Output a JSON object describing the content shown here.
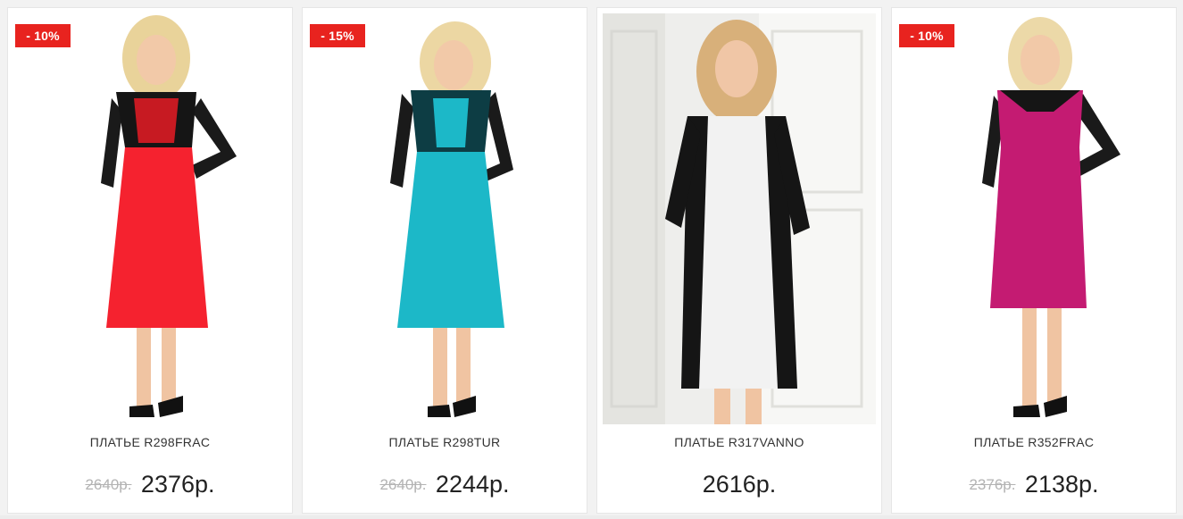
{
  "products": [
    {
      "badge": "- 10%",
      "title": "ПЛАТЬЕ R298FRAC",
      "old_price": "2640р.",
      "price": "2376р.",
      "dress_color": "#f5222f",
      "image_alt": "dress-red"
    },
    {
      "badge": "- 15%",
      "title": "ПЛАТЬЕ R298TUR",
      "old_price": "2640р.",
      "price": "2244р.",
      "dress_color": "#1cb8c8",
      "image_alt": "dress-turquoise"
    },
    {
      "badge": "",
      "title": "ПЛАТЬЕ R317VANNO",
      "old_price": "",
      "price": "2616р.",
      "dress_color": "#f2f2f2",
      "image_alt": "dress-white-black"
    },
    {
      "badge": "- 10%",
      "title": "ПЛАТЬЕ R352FRAC",
      "old_price": "2376р.",
      "price": "2138р.",
      "dress_color": "#c41b72",
      "image_alt": "dress-magenta"
    }
  ]
}
